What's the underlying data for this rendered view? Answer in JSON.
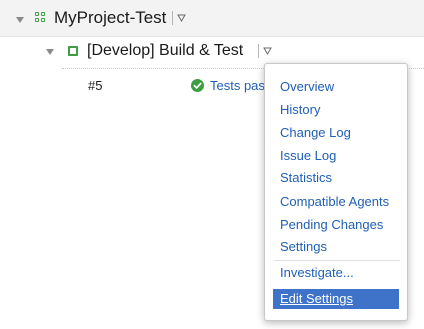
{
  "project": {
    "title": "MyProject-Test"
  },
  "build_configuration": {
    "title": "[Develop] Build & Test"
  },
  "build": {
    "number": "#5",
    "status_text": "Tests passed"
  },
  "popup_menu": {
    "items": [
      "Overview",
      "History",
      "Change Log",
      "Issue Log",
      "Statistics",
      "Compatible Agents",
      "Pending Changes",
      "Settings",
      "Investigate...",
      "Edit Settings"
    ],
    "highlighted_item": "Edit Settings"
  },
  "colors": {
    "link": "#1f5fb6",
    "success": "#3e9e43",
    "highlight": "#3f73c9"
  },
  "icons": {
    "project": "project-grid-icon",
    "build_configuration": "build-config-square-icon",
    "status": "success-check-icon",
    "dropdown": "chevron-down-icon",
    "expand": "expand-triangle-icon"
  }
}
